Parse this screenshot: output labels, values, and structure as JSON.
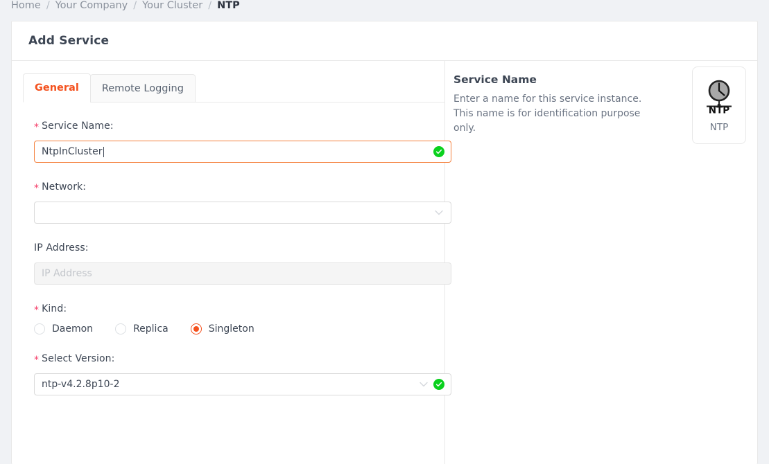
{
  "breadcrumb": {
    "items": [
      {
        "label": "Home",
        "current": false
      },
      {
        "label": "Your Company",
        "current": false
      },
      {
        "label": "Your Cluster",
        "current": false
      },
      {
        "label": "NTP",
        "current": true
      }
    ],
    "separator": "/"
  },
  "card": {
    "title": "Add Service"
  },
  "tabs": [
    {
      "label": "General",
      "active": true
    },
    {
      "label": "Remote Logging",
      "active": false
    }
  ],
  "form": {
    "service_name": {
      "label": "Service Name",
      "suffix": ":",
      "required": true,
      "value": "NtpInCluster",
      "placeholder": "",
      "valid": true,
      "focused": true
    },
    "network": {
      "label": "Network",
      "suffix": ":",
      "required": true,
      "value": "",
      "placeholder": "",
      "valid": false
    },
    "ip_address": {
      "label": "IP Address",
      "suffix": ":",
      "required": false,
      "value": "",
      "placeholder": "IP Address",
      "disabled": true
    },
    "kind": {
      "label": "Kind",
      "suffix": ":",
      "required": true,
      "selected": "Singleton",
      "options": [
        "Daemon",
        "Replica",
        "Singleton"
      ]
    },
    "select_version": {
      "label": "Select Version",
      "suffix": ":",
      "required": true,
      "value": "ntp-v4.2.8p10-2",
      "valid": true
    }
  },
  "help": {
    "title": "Service Name",
    "text": "Enter a name for this service instance. This name is for identification purpose only."
  },
  "service_icon": {
    "caption": "NTP",
    "glyph_label": "NTP",
    "icon_name": "ntp-clock-icon"
  },
  "icons": {
    "required_mark": "*",
    "chevron_down": "chevron-down-icon",
    "valid_check": "check-circle-icon"
  },
  "colors": {
    "accent": "#f4511e",
    "focus_border": "#f4803c",
    "required": "#f5426c",
    "success": "#0ad11e",
    "page_bg": "#f0f2f5",
    "border": "#e8e8e8",
    "text": "#3d4654",
    "muted": "#6b7483"
  }
}
